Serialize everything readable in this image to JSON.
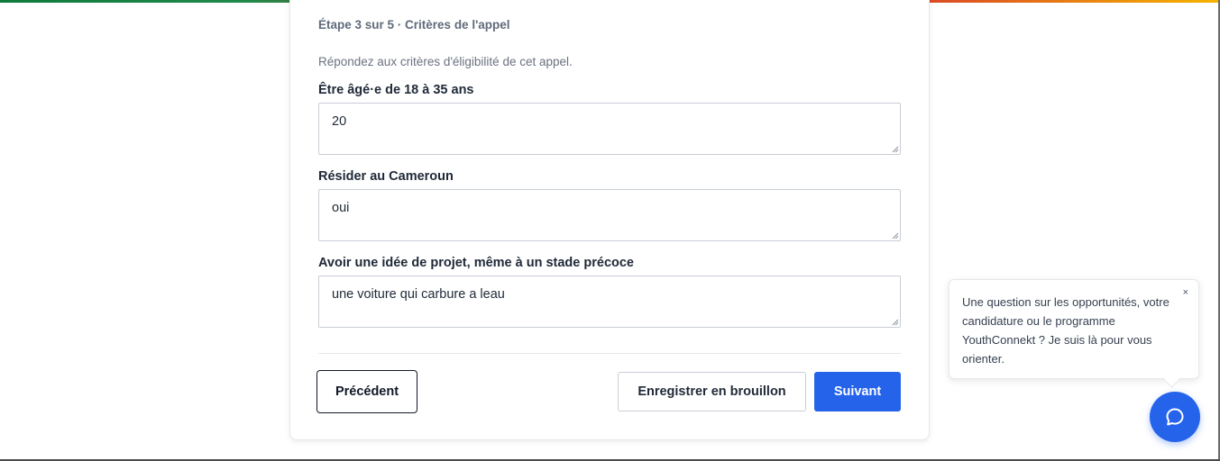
{
  "step": {
    "label": "Étape 3 sur 5 · Critères de l'appel"
  },
  "intro": "Répondez aux critères d'éligibilité de cet appel.",
  "fields": [
    {
      "label": "Être âgé·e de 18 à 35 ans",
      "value": "20"
    },
    {
      "label": "Résider au Cameroun",
      "value": "oui"
    },
    {
      "label": "Avoir une idée de projet, même à un stade précoce",
      "value": "une voiture qui carbure a leau"
    }
  ],
  "buttons": {
    "previous": "Précédent",
    "save_draft": "Enregistrer en brouillon",
    "next": "Suivant"
  },
  "chat": {
    "message": "Une question sur les opportunités, votre candidature ou le programme YouthConnekt ? Je suis là pour vous orienter.",
    "close": "×",
    "icon": "chat-bubble-icon"
  },
  "colors": {
    "primary": "#2563eb",
    "text": "#1f2937",
    "muted": "#6b7280",
    "accent_gradient": [
      "#0f7a3d",
      "#c0392b",
      "#f5b400"
    ]
  }
}
